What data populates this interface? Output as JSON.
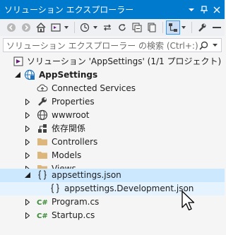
{
  "window": {
    "title": "ソリューション エクスプローラー"
  },
  "search": {
    "placeholder": "ソリューション エクスプローラー の検索 (Ctrl+:)"
  },
  "tree": {
    "solution_label": "ソリューション 'AppSettings' (1/1 プロジェクト)",
    "project_label": "AppSettings",
    "items": [
      {
        "label": "Connected Services",
        "icon": "cloud-icon"
      },
      {
        "label": "Properties",
        "icon": "wrench-icon"
      },
      {
        "label": "wwwroot",
        "icon": "globe-icon"
      },
      {
        "label": "依存関係",
        "icon": "dependencies-icon"
      },
      {
        "label": "Controllers",
        "icon": "folder-icon"
      },
      {
        "label": "Models",
        "icon": "folder-icon"
      },
      {
        "label": "Views",
        "icon": "folder-icon"
      },
      {
        "label": "appsettings.json",
        "icon": "json-file-icon"
      },
      {
        "label": "appsettings.Development.json",
        "icon": "json-file-icon"
      },
      {
        "label": "Program.cs",
        "icon": "csharp-file-icon"
      },
      {
        "label": "Startup.cs",
        "icon": "csharp-file-icon"
      }
    ]
  },
  "colors": {
    "title_bar": "#007acc",
    "selection": "#cce8ff",
    "folder": "#dcb67a",
    "csharp": "#388a34"
  }
}
